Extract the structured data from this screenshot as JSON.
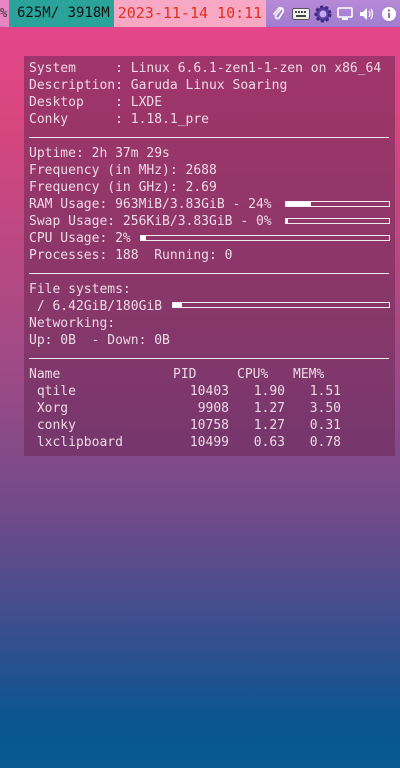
{
  "topbar": {
    "pct_glyph": "%",
    "memory": "625M/ 3918M",
    "datetime": "2023-11-14 10:11",
    "tray_icons": [
      "paperclip-icon",
      "keyboard-icon",
      "gear-icon",
      "monitor-icon",
      "volume-icon",
      "info-icon"
    ]
  },
  "system": {
    "system": "System     : Linux 6.6.1-zen1-1-zen on x86_64",
    "description": "Description: Garuda Linux Soaring",
    "desktop": "Desktop    : LXDE",
    "conky": "Conky      : 1.18.1_pre"
  },
  "stats": {
    "uptime": "Uptime: 2h 37m 29s",
    "freq_mhz": "Frequency (in MHz): 2688",
    "freq_ghz": "Frequency (in GHz): 2.69",
    "ram": "RAM Usage: 963MiB/3.83GiB - 24%",
    "ram_pct": 24,
    "swap": "Swap Usage: 256KiB/3.83GiB - 0%",
    "swap_pct": 0,
    "cpu": "CPU Usage: 2%",
    "cpu_pct": 2,
    "processes": "Processes: 188  Running: 0"
  },
  "filesystems": {
    "heading": "File systems:",
    "root": " / 6.42GiB/180GiB",
    "root_pct": 4,
    "net_heading": "Networking:",
    "net": "Up: 0B  - Down: 0B"
  },
  "processes": {
    "headers": {
      "name": "Name",
      "pid": "PID",
      "cpu": "CPU%",
      "mem": "MEM%"
    },
    "rows": [
      {
        "name": " qtile",
        "pid": "10403",
        "cpu": "1.90",
        "mem": "1.51"
      },
      {
        "name": " Xorg",
        "pid": "9908",
        "cpu": "1.27",
        "mem": "3.50"
      },
      {
        "name": " conky",
        "pid": "10758",
        "cpu": "1.27",
        "mem": "0.31"
      },
      {
        "name": " lxclipboard",
        "pid": "10499",
        "cpu": "0.63",
        "mem": "0.78"
      }
    ]
  }
}
